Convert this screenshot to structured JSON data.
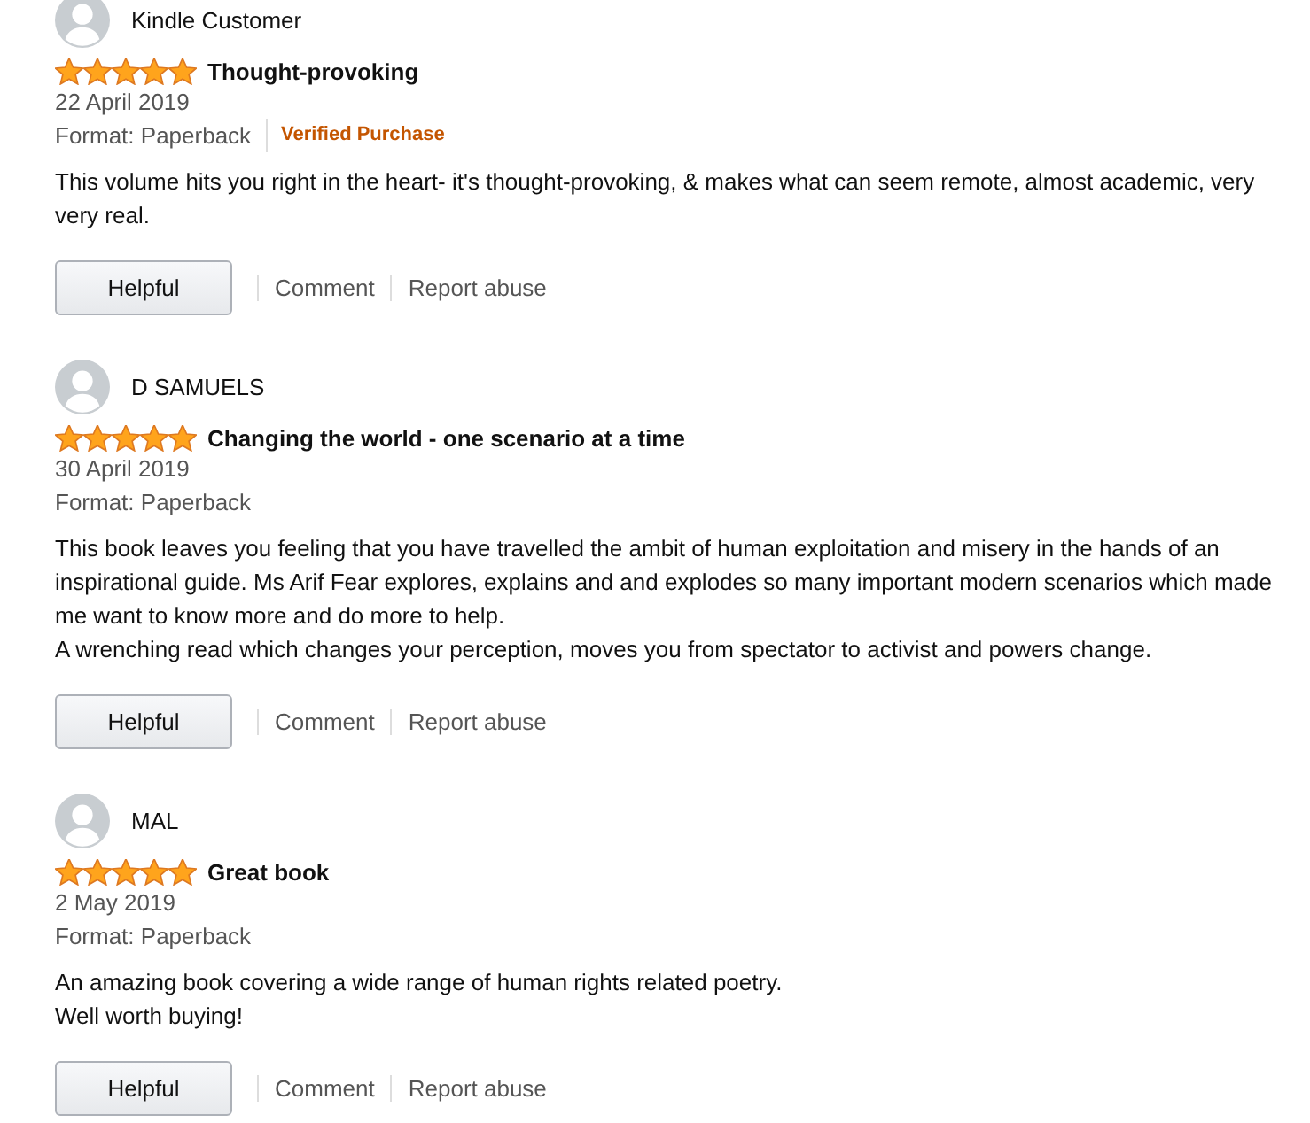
{
  "reviews": [
    {
      "author": "Kindle Customer",
      "stars": 5,
      "title": "Thought-provoking",
      "date": "22 April 2019",
      "format": "Format: Paperback",
      "badge": "Verified Purchase",
      "paragraphs": [
        "This volume hits you right in the heart- it's thought-provoking, & makes what can seem remote, almost academic, very very real."
      ],
      "actions": {
        "helpful": "Helpful",
        "comment": "Comment",
        "report": "Report abuse"
      }
    },
    {
      "author": "D SAMUELS",
      "stars": 5,
      "title": "Changing the world - one scenario at a time",
      "date": "30 April 2019",
      "format": "Format: Paperback",
      "paragraphs": [
        "This book leaves you feeling that you have travelled the ambit of human exploitation and misery in the hands of an inspirational guide. Ms Arif Fear explores, explains and and explodes so many important modern scenarios which made me want to know more and do more to help.",
        "A wrenching read which changes your perception, moves you from spectator to activist and powers change."
      ],
      "actions": {
        "helpful": "Helpful",
        "comment": "Comment",
        "report": "Report abuse"
      }
    },
    {
      "author": "MAL",
      "stars": 5,
      "title": "Great book",
      "date": "2 May 2019",
      "format": "Format: Paperback",
      "paragraphs": [
        "An amazing book covering a wide range of human rights related poetry.",
        "Well worth buying!"
      ],
      "actions": {
        "helpful": "Helpful",
        "comment": "Comment",
        "report": "Report abuse"
      }
    }
  ]
}
